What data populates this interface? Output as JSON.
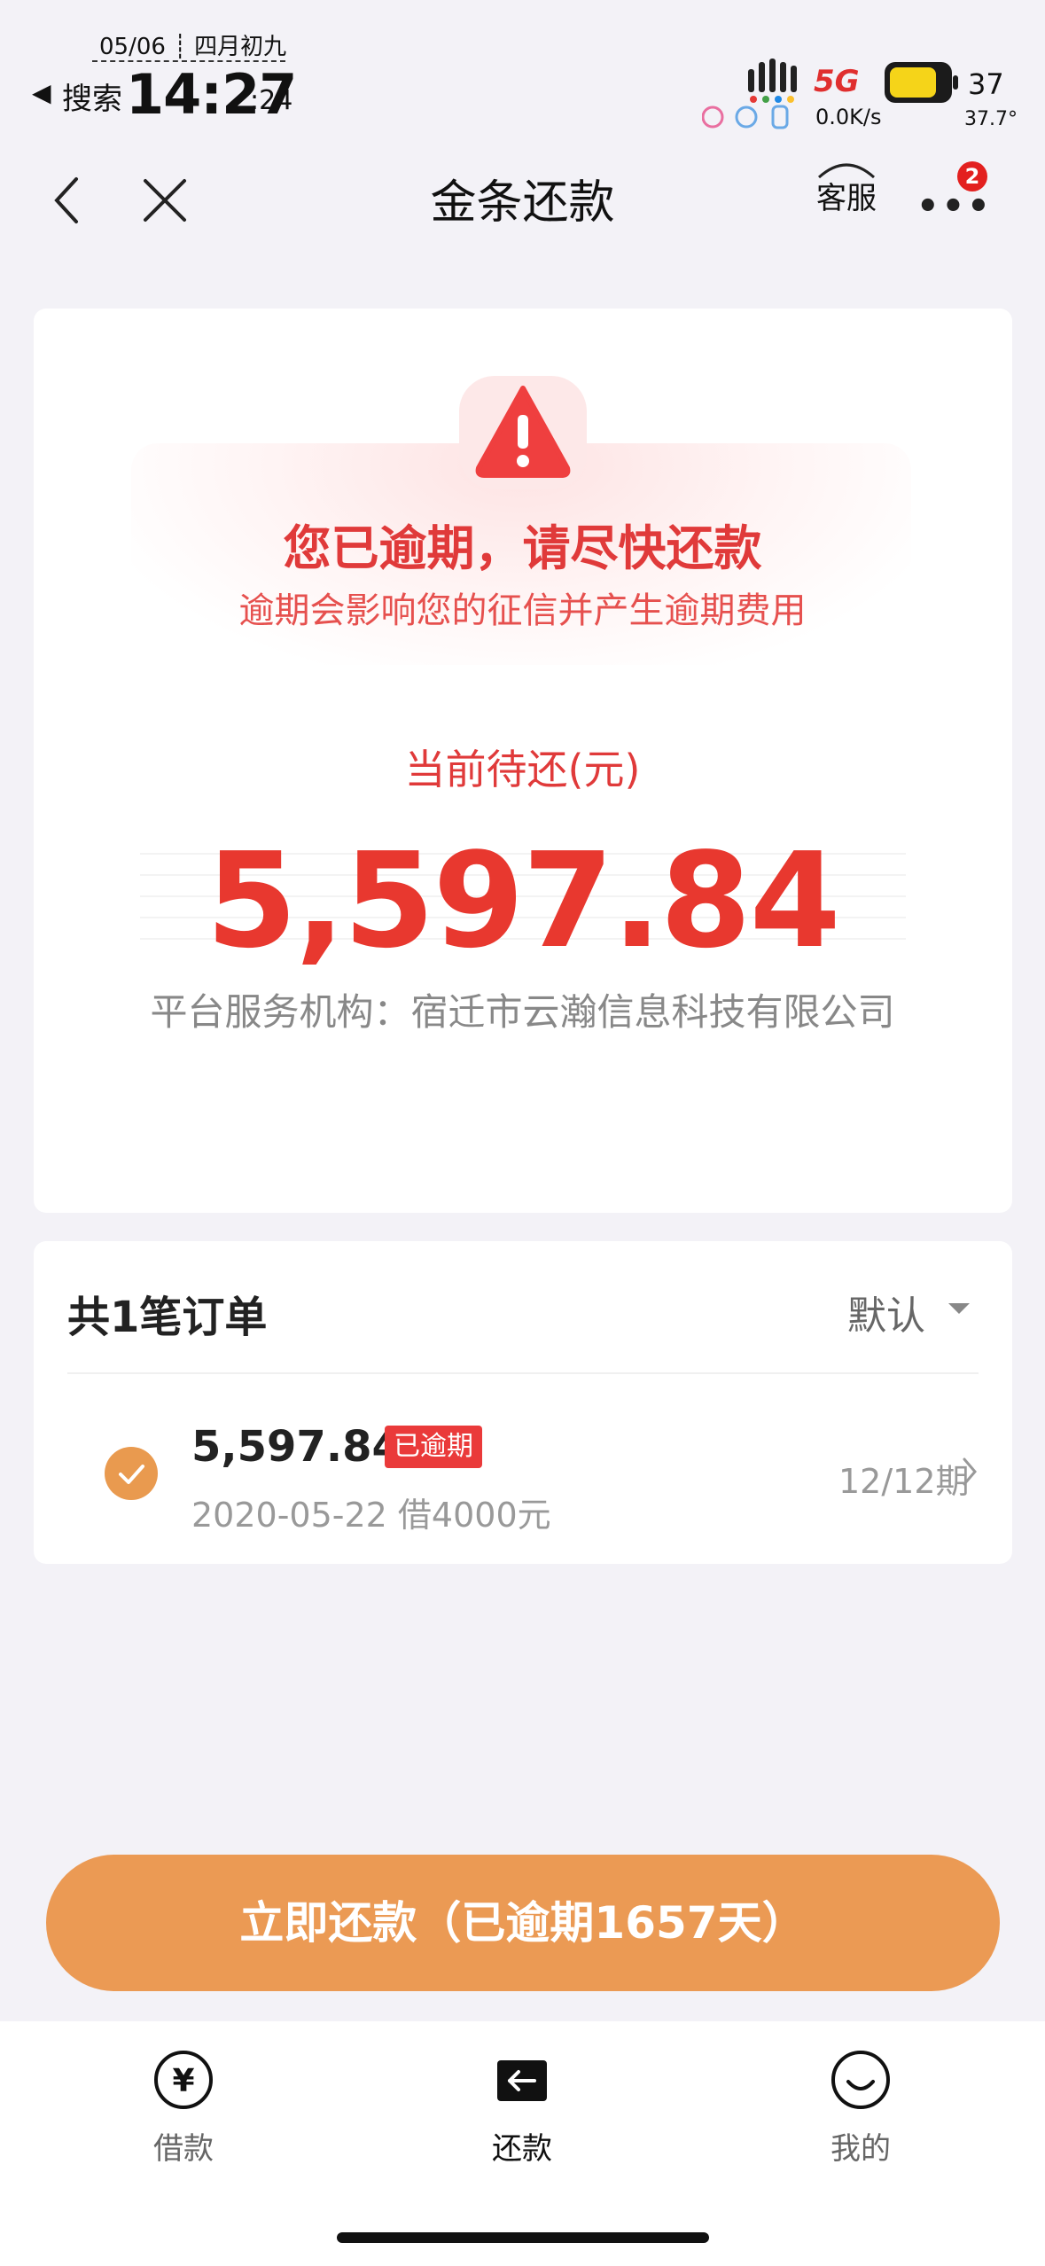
{
  "status_bar": {
    "date": "05/06 ┊ 四月初九",
    "back_indicator": "◀",
    "back_app": "搜索",
    "time": "14:27",
    "seconds": ":24",
    "network": "5G",
    "speed": "0.0K/s",
    "battery": "37",
    "temperature": "37.7°"
  },
  "nav": {
    "title": "金条还款",
    "customer_service": "客服",
    "more_badge": "2"
  },
  "overdue_card": {
    "warning_title": "您已逾期，请尽快还款",
    "warning_subtitle": "逾期会影响您的征信并产生逾期费用",
    "due_label": "当前待还(元)",
    "due_amount": "5,597.84",
    "platform": "平台服务机构：宿迁市云瀚信息科技有限公司"
  },
  "orders": {
    "title": "共1笔订单",
    "sort": "默认",
    "items": [
      {
        "amount": "5,597.84",
        "badge": "已逾期",
        "detail": "2020-05-22 借4000元",
        "period": "12/12期"
      }
    ]
  },
  "cta": {
    "label": "立即还款（已逾期1657天）"
  },
  "tabs": [
    {
      "label": "借款",
      "icon": "yen-circle-icon"
    },
    {
      "label": "还款",
      "icon": "repay-arrow-icon"
    },
    {
      "label": "我的",
      "icon": "smile-icon"
    }
  ],
  "colors": {
    "accent_orange": "#eb9a54",
    "overdue_red": "#e8382f",
    "background": "#f3f2f7"
  }
}
